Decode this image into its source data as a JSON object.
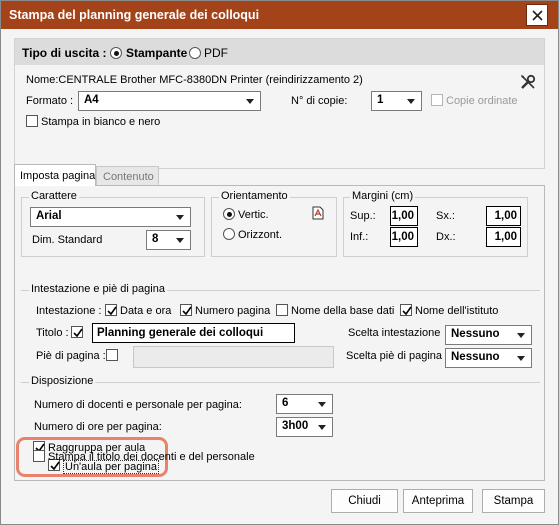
{
  "window": {
    "title": "Stampa del planning generale dei colloqui"
  },
  "output": {
    "label": "Tipo di uscita :",
    "options": [
      "Stampante",
      "PDF"
    ],
    "selected": "Stampante"
  },
  "printer": {
    "name_text": "Nome:CENTRALE Brother MFC-8380DN Printer (reindirizzamento 2)",
    "format_label": "Formato :",
    "format_value": "A4",
    "copies_label": "N° di copie:",
    "copies_value": "1",
    "collate_label": "Copie ordinate",
    "collate_checked": false,
    "bw_label": "Stampa in bianco e nero",
    "bw_checked": false
  },
  "tabs": [
    {
      "label": "Imposta pagina",
      "active": true
    },
    {
      "label": "Contenuto",
      "active": false
    }
  ],
  "font_group": {
    "title": "Carattere",
    "font_value": "Arial",
    "size_label": "Dim. Standard",
    "size_value": "8"
  },
  "orientation": {
    "title": "Orientamento",
    "options": [
      "Vertic.",
      "Orizzont."
    ],
    "selected": "Vertic."
  },
  "margins": {
    "title": "Margini (cm)",
    "sup_label": "Sup.:",
    "sup_value": "1,00",
    "inf_label": "Inf.:",
    "inf_value": "1,00",
    "sx_label": "Sx.:",
    "sx_value": "1,00",
    "dx_label": "Dx.:",
    "dx_value": "1,00"
  },
  "header_footer": {
    "title": "Intestazione e piè di pagina",
    "header_label": "Intestazione :",
    "checks": [
      {
        "label": "Data e ora",
        "checked": true
      },
      {
        "label": "Numero pagina",
        "checked": true
      },
      {
        "label": "Nome della base dati",
        "checked": false
      },
      {
        "label": "Nome dell'istituto",
        "checked": true
      }
    ],
    "title_label": "Titolo :",
    "title_checked": true,
    "title_value": "Planning generale dei colloqui",
    "footer_label": "Piè di pagina :",
    "footer_checked": false,
    "footer_value": "",
    "header_choice_label": "Scelta intestazione",
    "header_choice_value": "Nessuno",
    "footer_choice_label": "Scelta piè di pagina",
    "footer_choice_value": "Nessuno"
  },
  "layout": {
    "title": "Disposizione",
    "per_page_label": "Numero di docenti e personale per pagina:",
    "per_page_value": "6",
    "hours_label": "Numero di ore per pagina:",
    "hours_value": "3h00",
    "group_room_label": "Raggruppa per aula",
    "group_room_checked": true,
    "one_room_label": "Un'aula per pagina",
    "one_room_checked": true,
    "print_title_label": "Stampa il titolo dei docenti e del personale",
    "print_title_checked": false,
    "highlight_color": "#e8826a"
  },
  "buttons": {
    "close": "Chiudi",
    "preview": "Anteprima",
    "print": "Stampa"
  },
  "colors": {
    "titlebar": "#a4431a"
  }
}
